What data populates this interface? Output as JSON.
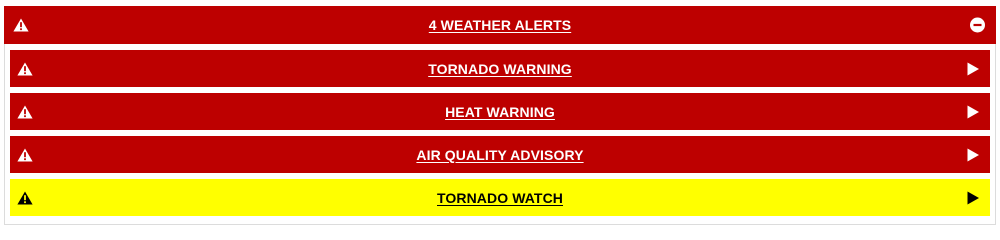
{
  "colors": {
    "red": "#bd0000",
    "yellow": "#ffff00",
    "text_on_red": "#ffffff",
    "text_on_yellow": "#000000"
  },
  "header": {
    "title": "4 WEATHER ALERTS",
    "left_icon": "warning-triangle-icon",
    "right_icon": "collapse-minus-icon"
  },
  "alerts": [
    {
      "title": "TORNADO WARNING",
      "severity": "warning",
      "left_icon": "warning-triangle-icon",
      "right_icon": "expand-arrow-icon"
    },
    {
      "title": "HEAT WARNING",
      "severity": "warning",
      "left_icon": "warning-triangle-icon",
      "right_icon": "expand-arrow-icon"
    },
    {
      "title": "AIR QUALITY ADVISORY",
      "severity": "warning",
      "left_icon": "warning-triangle-icon",
      "right_icon": "expand-arrow-icon"
    },
    {
      "title": "TORNADO WATCH",
      "severity": "watch",
      "left_icon": "warning-triangle-icon",
      "right_icon": "expand-arrow-icon"
    }
  ]
}
